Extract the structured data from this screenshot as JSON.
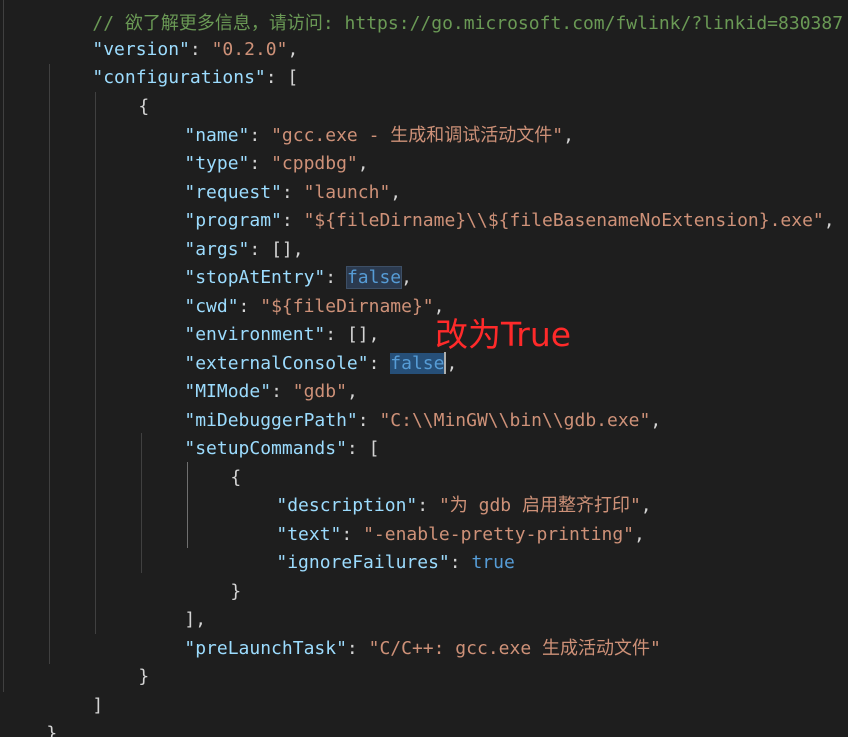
{
  "editor": {
    "partial_top_comment": "// 欲了解更多信息，请访问: https://go.microsoft.com/fwlink/?linkid=830387",
    "lines": {
      "version_key": "\"version\"",
      "version_val": "\"0.2.0\"",
      "configurations_key": "\"configurations\"",
      "name_key": "\"name\"",
      "name_val": "\"gcc.exe - 生成和调试活动文件\"",
      "type_key": "\"type\"",
      "type_val": "\"cppdbg\"",
      "request_key": "\"request\"",
      "request_val": "\"launch\"",
      "program_key": "\"program\"",
      "program_val": "\"${fileDirname}\\\\${fileBasenameNoExtension}.exe\"",
      "args_key": "\"args\"",
      "args_val": "[]",
      "stopAtEntry_key": "\"stopAtEntry\"",
      "stopAtEntry_val": "false",
      "cwd_key": "\"cwd\"",
      "cwd_val": "\"${fileDirname}\"",
      "environment_key": "\"environment\"",
      "environment_val": "[]",
      "externalConsole_key": "\"externalConsole\"",
      "externalConsole_val": "false",
      "MIMode_key": "\"MIMode\"",
      "MIMode_val": "\"gdb\"",
      "miDebuggerPath_key": "\"miDebuggerPath\"",
      "miDebuggerPath_val": "\"C:\\\\MinGW\\\\bin\\\\gdb.exe\"",
      "setupCommands_key": "\"setupCommands\"",
      "description_key": "\"description\"",
      "description_val": "\"为 gdb 启用整齐打印\"",
      "text_key": "\"text\"",
      "text_val": "\"-enable-pretty-printing\"",
      "ignoreFailures_key": "\"ignoreFailures\"",
      "ignoreFailures_val": "true",
      "preLaunchTask_key": "\"preLaunchTask\"",
      "preLaunchTask_val": "\"C/C++: gcc.exe 生成活动文件\""
    }
  },
  "annotation": {
    "text": "改为True",
    "color": "#ff2a2a"
  },
  "theme": {
    "background": "#1e1e1e",
    "key_color": "#9cdcfe",
    "string_color": "#ce9178",
    "keyword_color": "#569cd6",
    "punctuation_color": "#d4d4d4",
    "selection_color": "#264f78"
  }
}
